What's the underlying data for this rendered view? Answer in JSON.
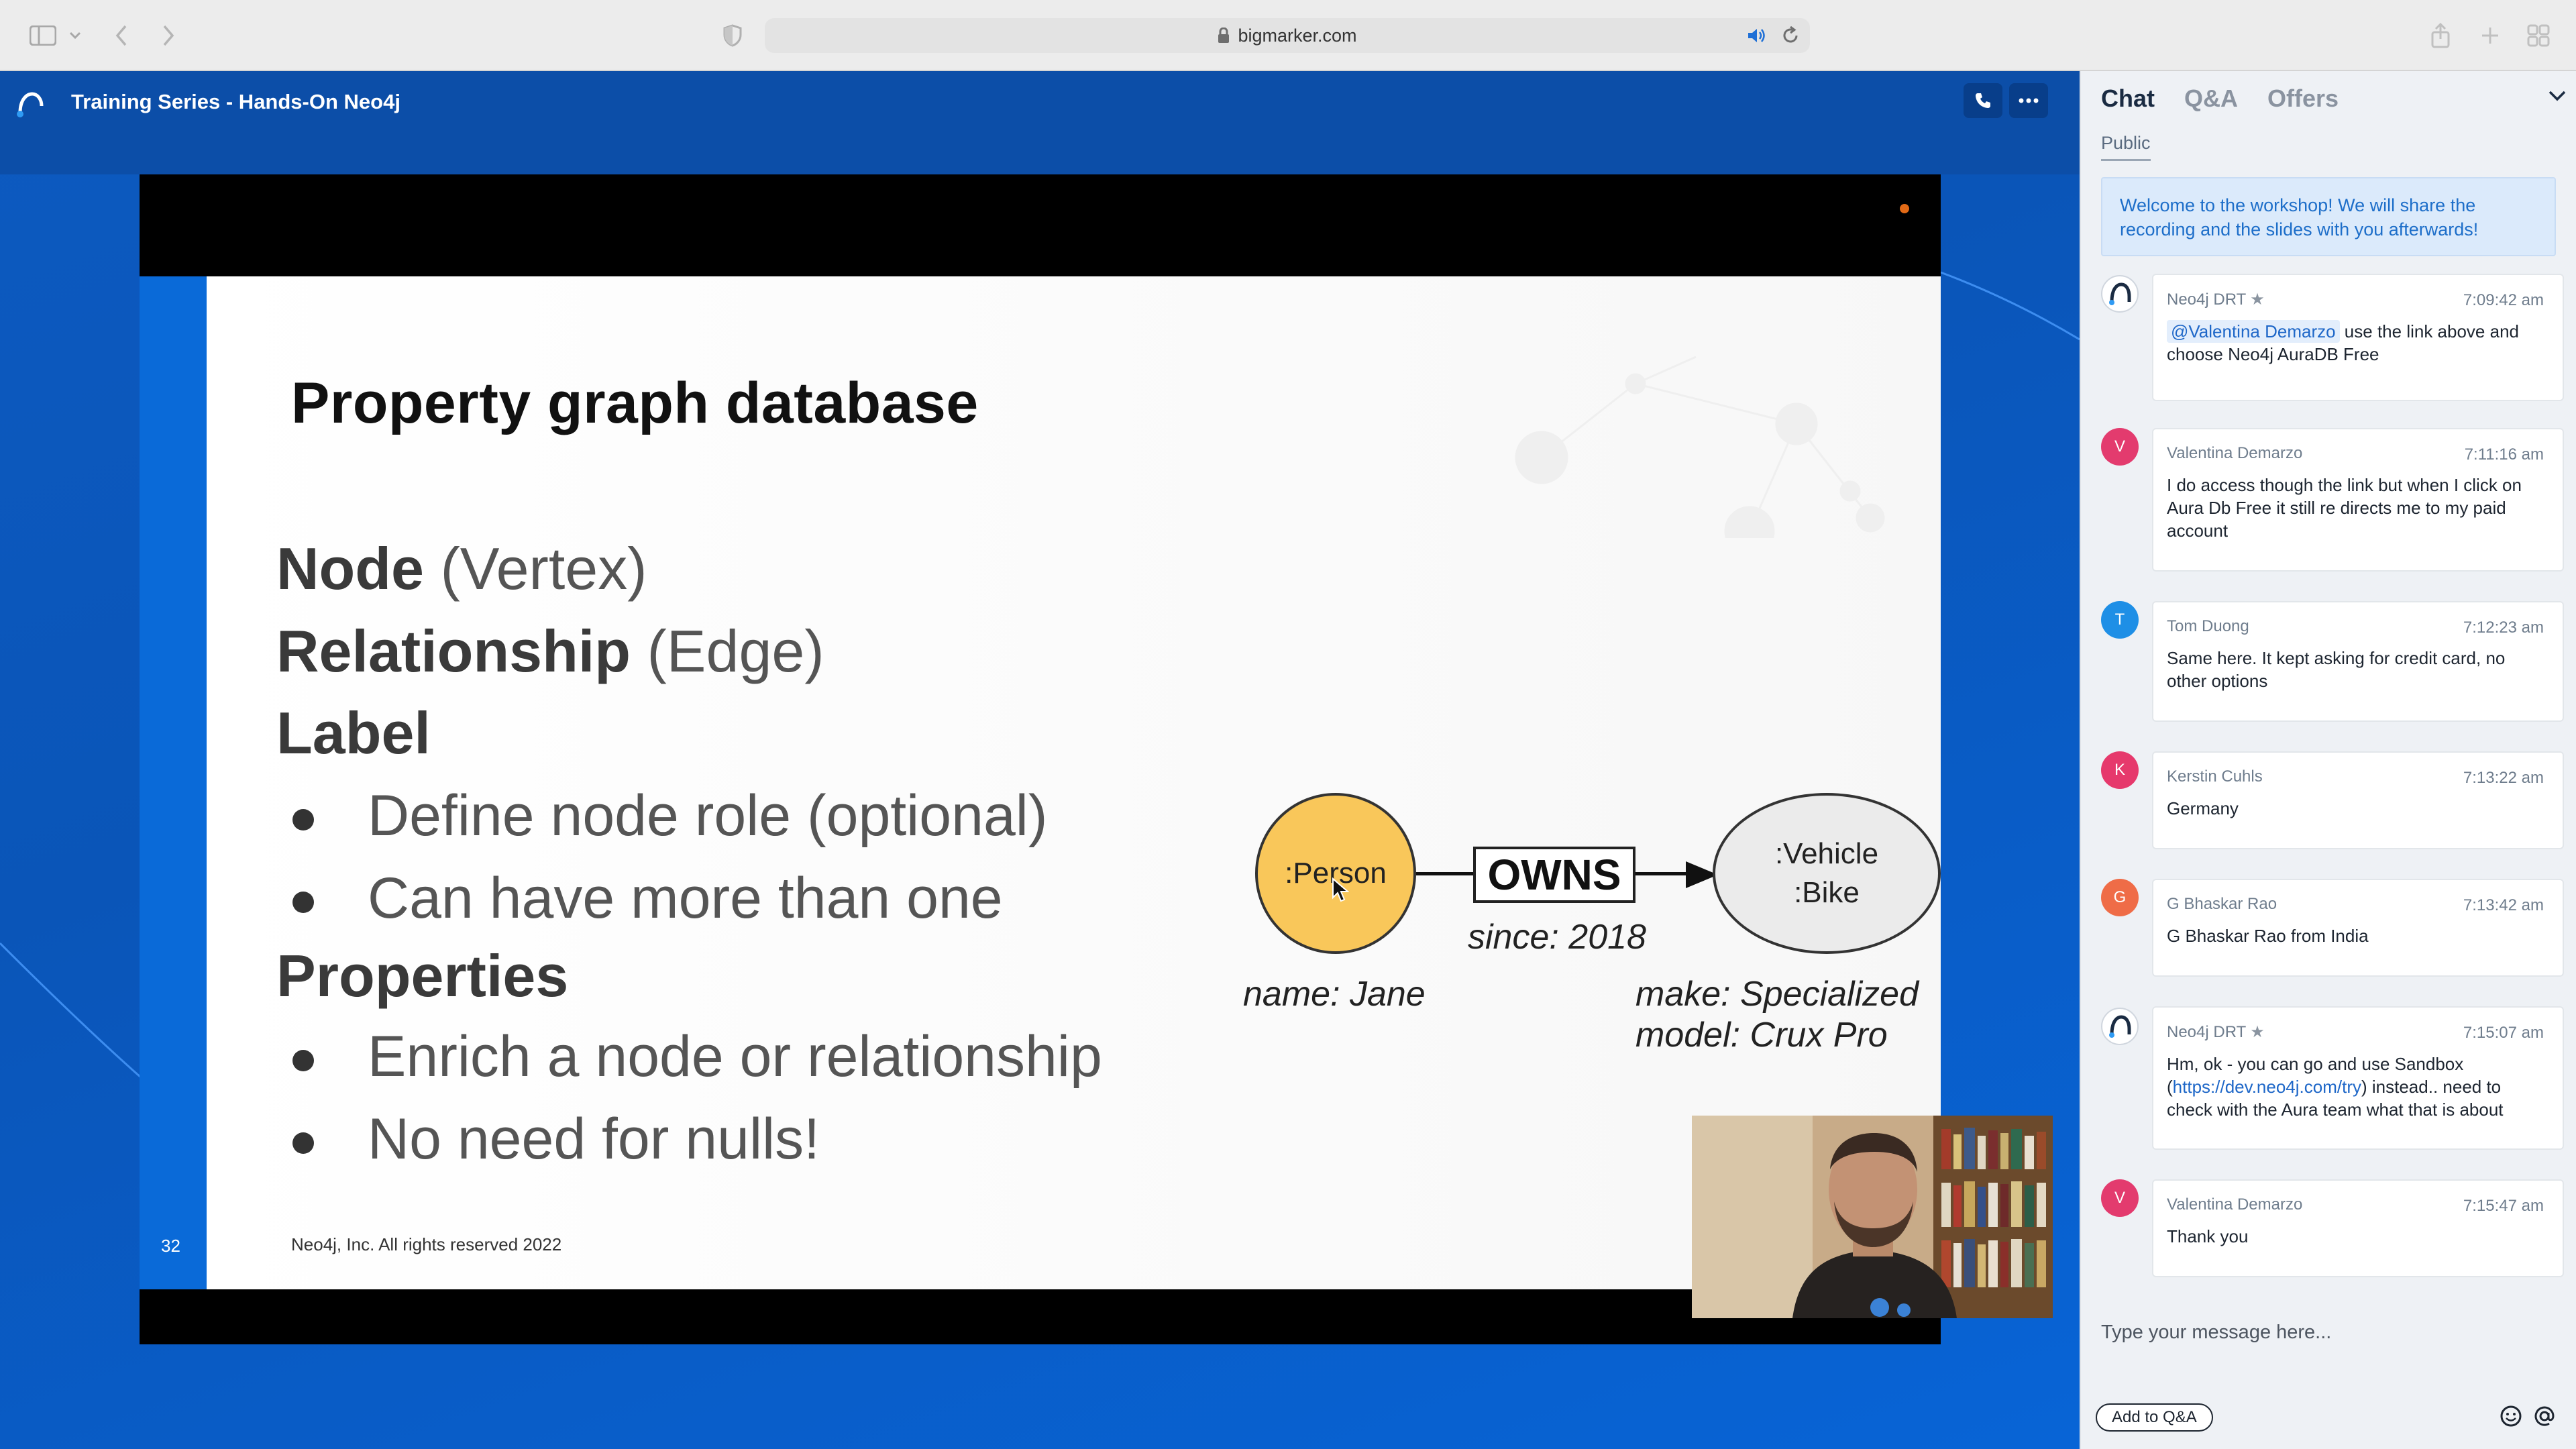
{
  "browser": {
    "url": "bigmarker.com"
  },
  "app": {
    "session_title": "Training Series - Hands-On Neo4j",
    "colors": {
      "header_bg": "#0c4ea8",
      "stage_bg": "#0864d6",
      "accent": "#1e67c8"
    }
  },
  "slide": {
    "title": "Property graph database",
    "lines": {
      "node_bold": "Node",
      "node_rest": " (Vertex)",
      "rel_bold": "Relationship",
      "rel_rest": " (Edge)",
      "label_bold": "Label",
      "label_b1": "Define node role (optional)",
      "label_b2": "Can have more than one",
      "props_bold": "Properties",
      "props_b1": "Enrich a node or relationship",
      "props_b2": "No need for nulls!"
    },
    "number": "32",
    "footer": "Neo4j, Inc. All rights reserved 2022",
    "graph": {
      "person_label": ":Person",
      "person_prop": "name: Jane",
      "relationship": "OWNS",
      "relationship_prop": "since: 2018",
      "vehicle_label_1": ":Vehicle",
      "vehicle_label_2": ":Bike",
      "vehicle_prop_1": "make: Specialized",
      "vehicle_prop_2": "model: Crux Pro"
    }
  },
  "chat": {
    "tabs": [
      "Chat",
      "Q&A",
      "Offers"
    ],
    "active_tab": "Chat",
    "channel": "Public",
    "welcome": "Welcome to the workshop! We will share the recording and the slides with you afterwards!",
    "messages": [
      {
        "author": "Neo4j DRT",
        "time": "7:09:42 am",
        "mention": "@Valentina Demarzo",
        "text": " use the link above and choose Neo4j AuraDB Free"
      },
      {
        "author": "Valentina Demarzo",
        "initial": "V",
        "time": "7:11:16 am",
        "text": "I do access though the link but when I click on Aura Db Free it still re directs me to my paid account"
      },
      {
        "author": "Tom Duong",
        "initial": "T",
        "time": "7:12:23 am",
        "text": "Same here. It kept asking for credit card, no other options"
      },
      {
        "author": "Kerstin Cuhls",
        "initial": "K",
        "time": "7:13:22 am",
        "text": "Germany"
      },
      {
        "author": "G Bhaskar Rao",
        "initial": "G",
        "time": "7:13:42 am",
        "text": "G Bhaskar Rao from India"
      },
      {
        "author": "Neo4j DRT",
        "time": "7:15:07 am",
        "text_before": "Hm, ok - you can go and use Sandbox (",
        "link": "https://dev.neo4j.com/try",
        "text_after": ") instead.. need to check with the Aura team what that is about"
      },
      {
        "author": "Valentina Demarzo",
        "initial": "V",
        "time": "7:15:47 am",
        "text": "Thank you"
      }
    ],
    "avatar_colors": {
      "V": "#e33b6e",
      "T": "#1e8fe6",
      "K": "#e6396c",
      "G": "#ef6c47"
    },
    "input_placeholder": "Type your message here...",
    "add_to_qa_label": "Add to Q&A"
  }
}
